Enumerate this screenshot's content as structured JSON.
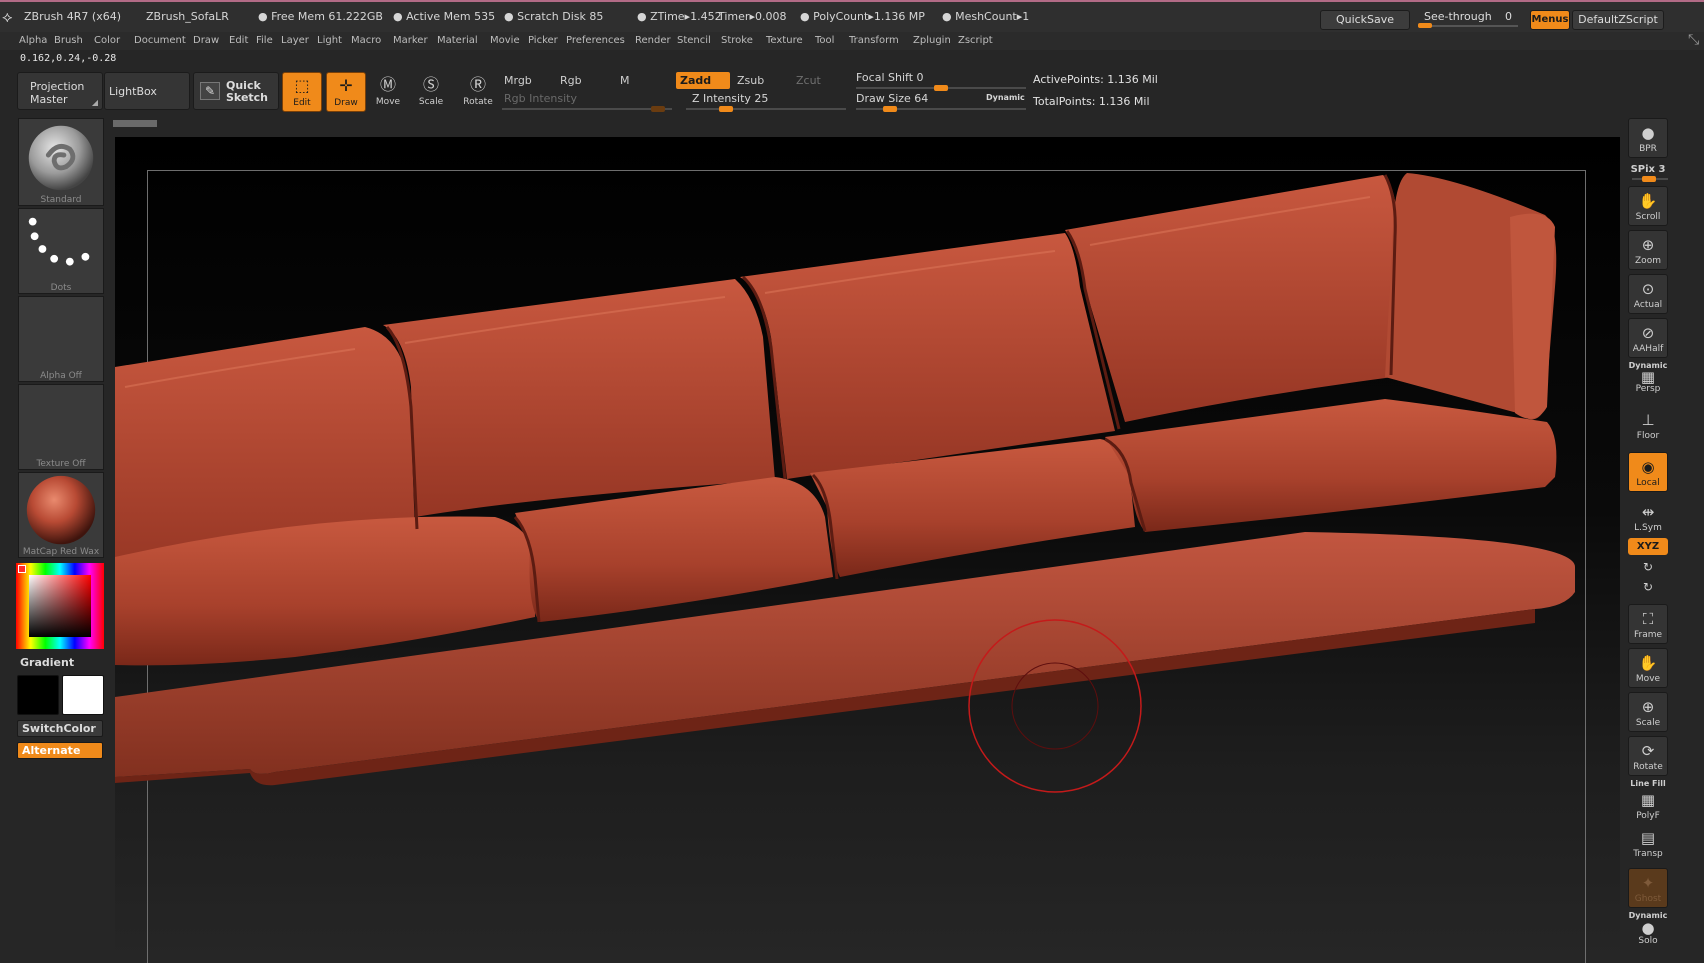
{
  "title": {
    "app": "ZBrush 4R7 (x64)",
    "doc": "ZBrush_SofaLR",
    "free_mem": "● Free Mem 61.222GB",
    "active_mem": "● Active Mem 535",
    "scratch": "● Scratch Disk 85",
    "ztime": "● ZTime▸1.452",
    "timer": "Timer▸0.008",
    "polycount": "● PolyCount▸1.136 MP",
    "meshcount": "● MeshCount▸1",
    "quicksave": "QuickSave",
    "see_through_label": "See-through",
    "see_through_value": "0",
    "see_through_level": 0,
    "menus": "Menus",
    "default_zscript": "DefaultZScript"
  },
  "menu": [
    "Alpha",
    "Brush",
    "Color",
    "Document",
    "Draw",
    "Edit",
    "File",
    "Layer",
    "Light",
    "Macro",
    "Marker",
    "Material",
    "Movie",
    "Picker",
    "Preferences",
    "Render",
    "Stencil",
    "Stroke",
    "Texture",
    "Tool",
    "Transform",
    "Zplugin",
    "Zscript"
  ],
  "coords": "0.162,0.24,-0.28",
  "toolbar": {
    "projection_master_1": "Projection",
    "projection_master_2": "Master",
    "lightbox": "LightBox",
    "quick_sketch_1": "Quick",
    "quick_sketch_2": "Sketch",
    "edit": "Edit",
    "draw": "Draw",
    "move": "Move",
    "scale": "Scale",
    "rotate": "Rotate",
    "mrgb": "Mrgb",
    "rgb": "Rgb",
    "m": "M",
    "zadd": "Zadd",
    "zsub": "Zsub",
    "zcut": "Zcut",
    "rgb_intensity": "Rgb Intensity",
    "z_intensity": "Z Intensity 25",
    "focal_shift": "Focal Shift 0",
    "draw_size": "Draw Size 64",
    "dynamic": "Dynamic",
    "active_points": "ActivePoints: 1.136 Mil",
    "total_points": "TotalPoints: 1.136 Mil"
  },
  "slider_levels": {
    "rgb_intensity": 0.92,
    "z_intensity": 0.25,
    "focal_shift": 0.5,
    "draw_size": 0.2
  },
  "left": {
    "brush": "Standard",
    "stroke": "Dots",
    "alpha": "Alpha Off",
    "texture": "Texture Off",
    "material": "MatCap Red Wax",
    "gradient": "Gradient",
    "switch_color": "SwitchColor",
    "alternate": "Alternate"
  },
  "right": {
    "bpr": "BPR",
    "spix": "SPix 3",
    "scroll": "Scroll",
    "zoom": "Zoom",
    "actual": "Actual",
    "aahalf": "AAHalf",
    "dynamic": "Dynamic",
    "persp": "Persp",
    "floor": "Floor",
    "local": "Local",
    "lsym": "L.Sym",
    "xyz": "XYZ",
    "frame": "Frame",
    "move": "Move",
    "scale": "Scale",
    "rotate": "Rotate",
    "line_fill": "Line Fill",
    "polyf": "PolyF",
    "transp": "Transp",
    "ghost": "Ghost",
    "dynamic2": "Dynamic",
    "solo": "Solo"
  },
  "colors": {
    "accent": "#f08a1a",
    "sofa": "#b84a34",
    "brush_cursor": "#c41a1a",
    "primary_color": "#000000",
    "secondary_color": "#ffffff"
  }
}
